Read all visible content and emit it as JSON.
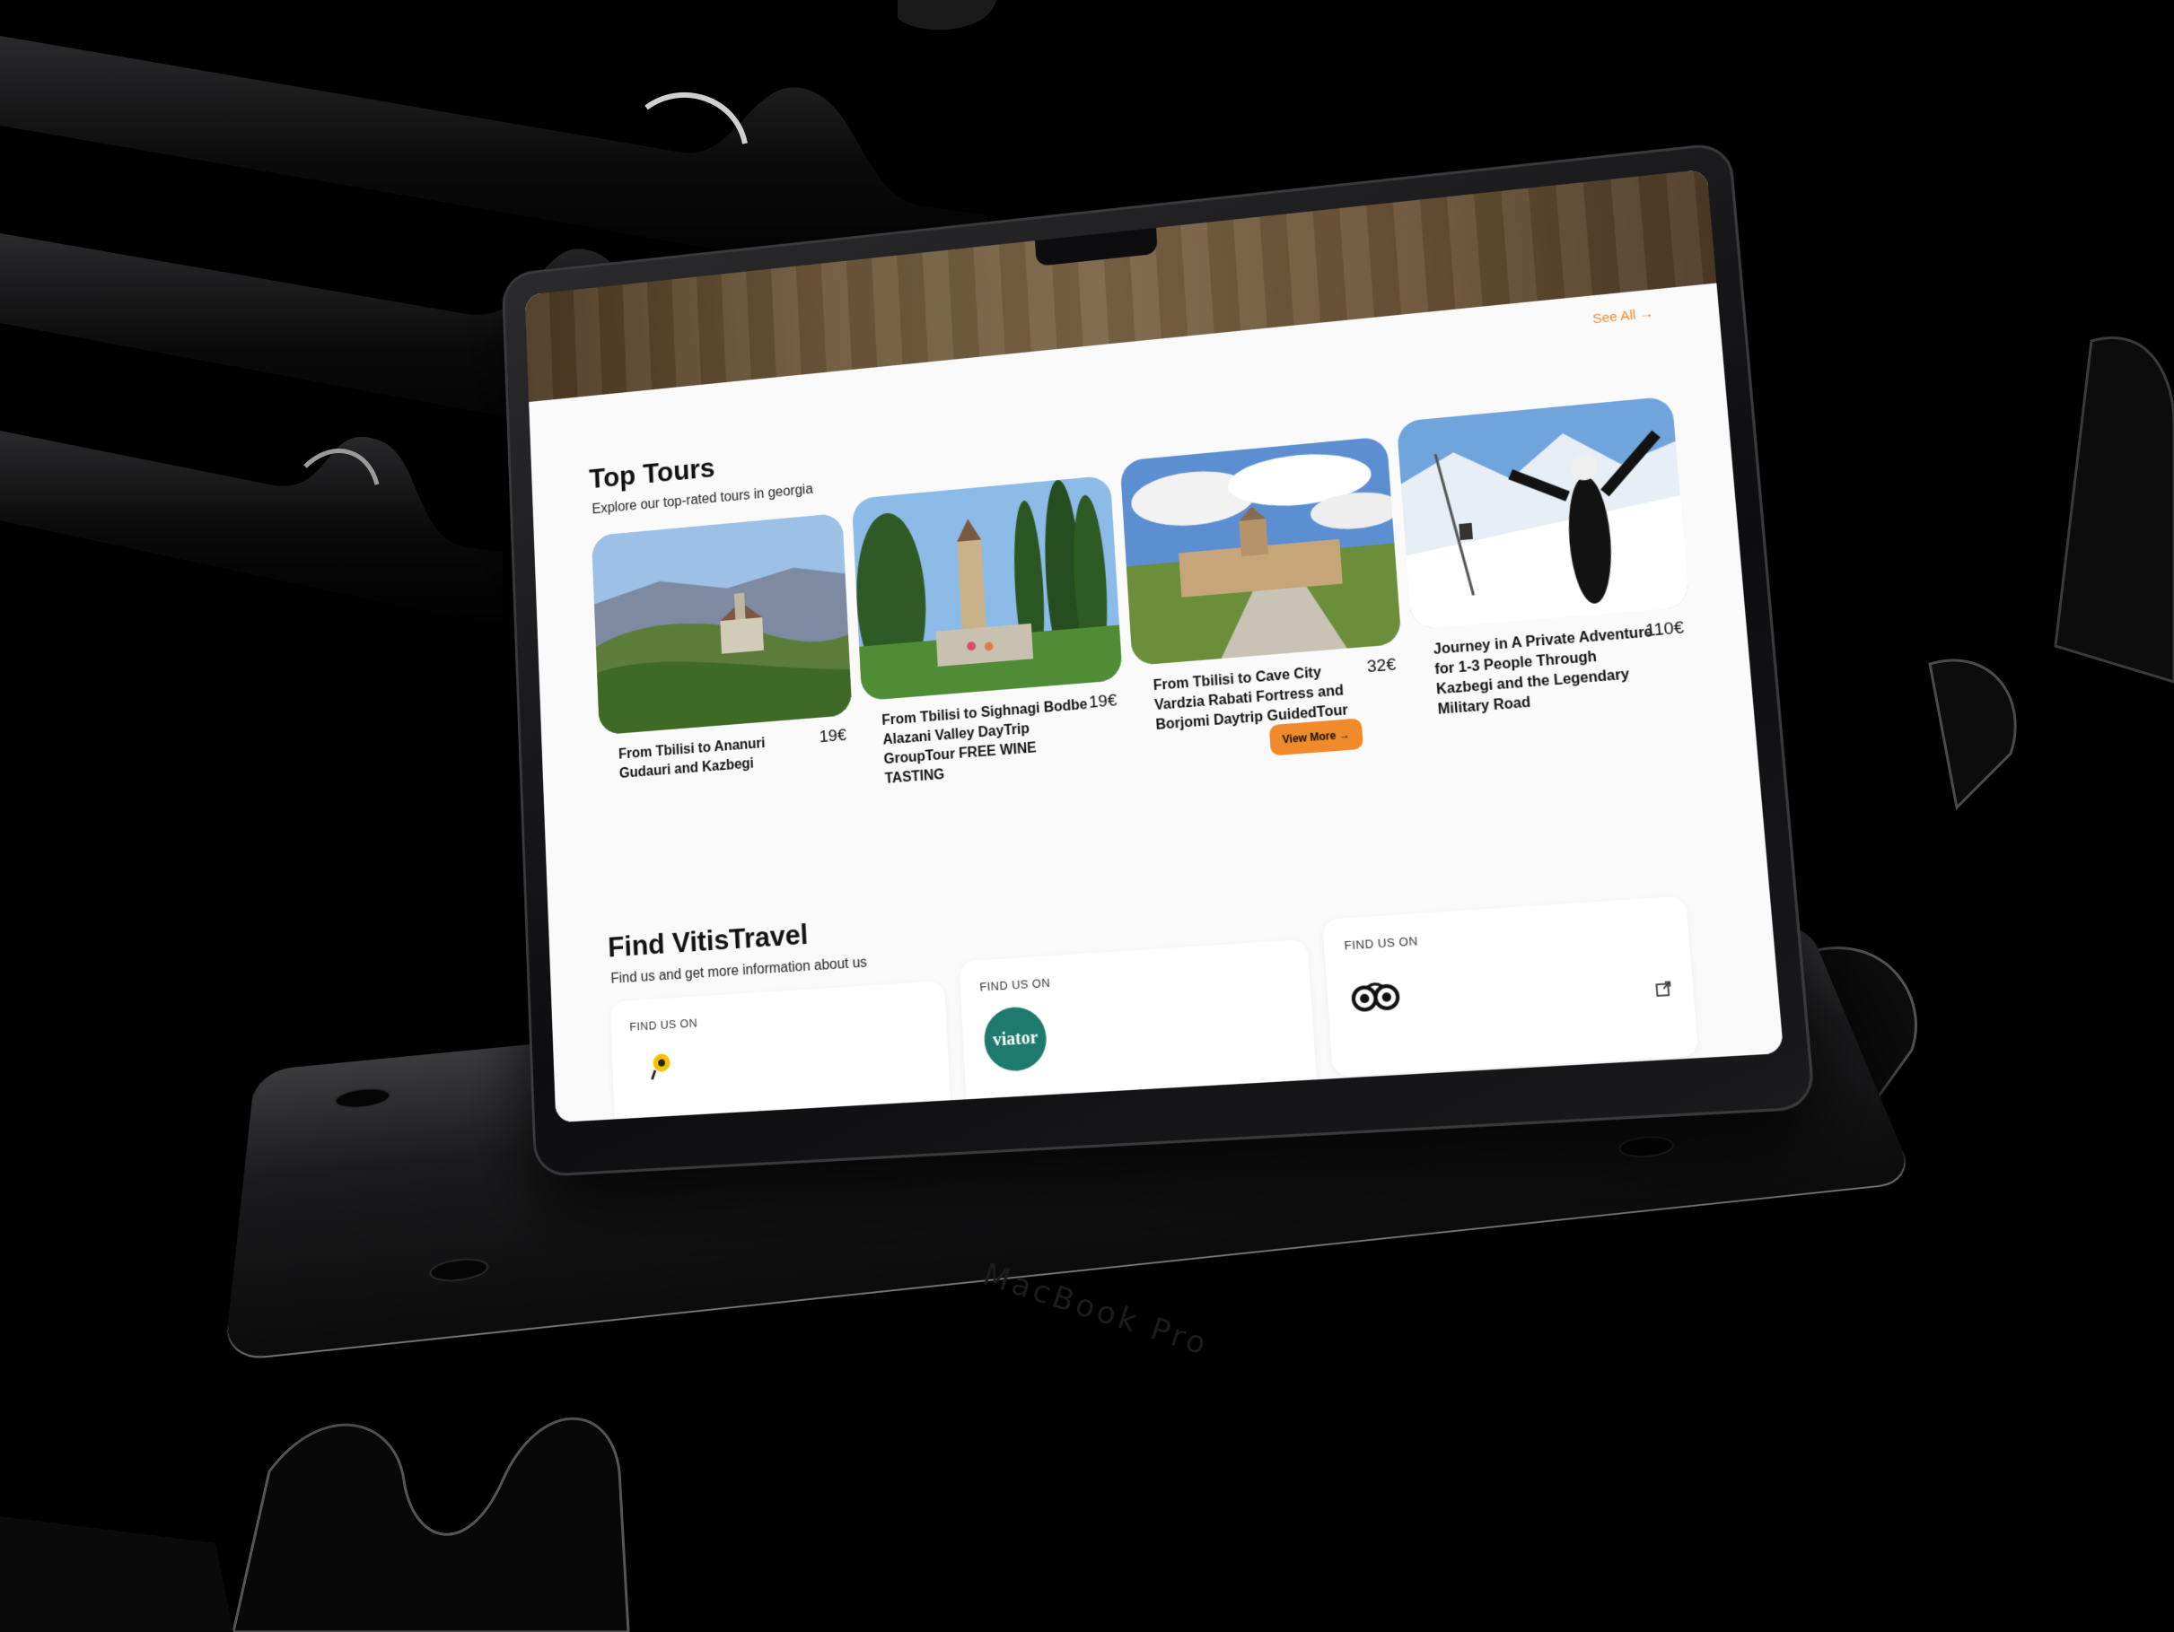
{
  "colors": {
    "accent": "#f08a2a",
    "background": "#000000",
    "screen_bg": "#fafafa"
  },
  "top_tours": {
    "see_all_label": "See All →",
    "title": "Top Tours",
    "subtitle": "Explore our top-rated tours in georgia",
    "view_more_label": "View More →",
    "cards": [
      {
        "name": "From Tbilisi to Ananuri Gudauri and Kazbegi",
        "price": "19€",
        "image": "mountain-church-photo"
      },
      {
        "name": "From Tbilisi to Sighnagi Bodbe Alazani Valley DayTrip GroupTour FREE WINE TASTING",
        "price": "19€",
        "image": "monastery-garden-photo"
      },
      {
        "name": "From Tbilisi to Cave City Vardzia Rabati Fortress and Borjomi Daytrip GuidedTour",
        "price": "32€",
        "image": "rabati-fortress-photo"
      },
      {
        "name": "Journey in A Private Adventure for 1-3 People Through Kazbegi and the Legendary Military Road",
        "price": "110€",
        "image": "snow-mountain-photo"
      }
    ]
  },
  "find_section": {
    "title": "Find VitisTravel",
    "subtitle": "Find us and get more information about us",
    "cards": [
      {
        "label": "FIND US ON",
        "logo": "pin-logo-icon"
      },
      {
        "label": "FIND US ON",
        "logo": "viator-logo",
        "logo_text": "viator"
      },
      {
        "label": "FIND US ON",
        "logo": "tripadvisor-owl-icon"
      }
    ]
  },
  "device": {
    "model_text": "MacBook Pro"
  }
}
